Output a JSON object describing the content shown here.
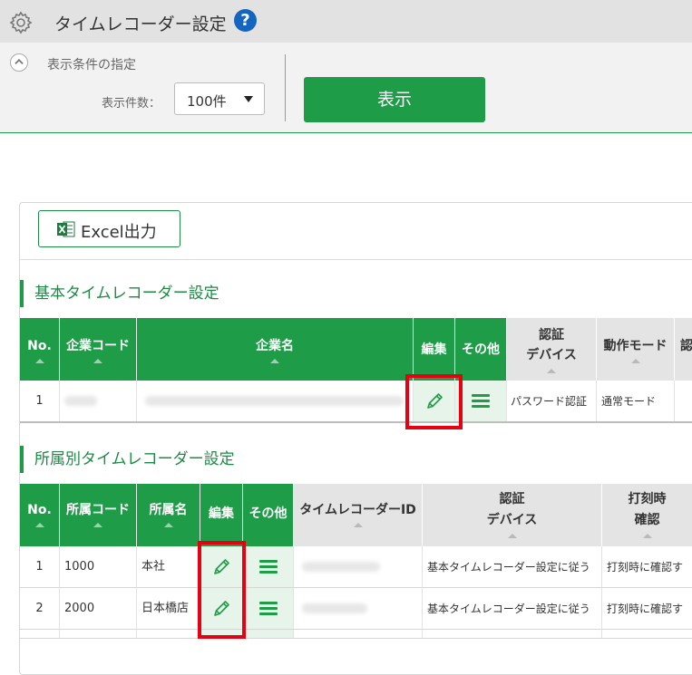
{
  "header": {
    "title": "タイムレコーダー設定",
    "help_glyph": "?"
  },
  "filter": {
    "title": "表示条件の指定",
    "count_label": "表示件数：",
    "count_value": "100件",
    "show_button": "表示"
  },
  "toolbar": {
    "excel_button": "Excel出力",
    "excel_icon": "excel-icon"
  },
  "basic": {
    "title": "基本タイムレコーダー設定",
    "headers": {
      "no": "No.",
      "company_code": "企業コード",
      "company_name": "企業名",
      "edit": "編集",
      "other": "その他",
      "auth_device_1": "認証",
      "auth_device_2": "デバイス",
      "mode": "動作モード",
      "cut": "認"
    },
    "rows": [
      {
        "no": "1",
        "auth_device": "パスワード認証",
        "mode": "通常モード"
      }
    ]
  },
  "dept": {
    "title": "所属別タイムレコーダー設定",
    "headers": {
      "no": "No.",
      "dept_code": "所属コード",
      "dept_name": "所属名",
      "edit": "編集",
      "other": "その他",
      "recorder_id": "タイムレコーダーID",
      "auth_device_1": "認証",
      "auth_device_2": "デバイス",
      "stamp_confirm_1": "打刻時",
      "stamp_confirm_2": "確認"
    },
    "rows": [
      {
        "no": "1",
        "code": "1000",
        "name": "本社",
        "auth_device": "基本タイムレコーダー設定に従う",
        "stamp_confirm": "打刻時に確認す"
      },
      {
        "no": "2",
        "code": "2000",
        "name": "日本橋店",
        "auth_device": "基本タイムレコーダー設定に従う",
        "stamp_confirm": "打刻時に確認す"
      }
    ]
  },
  "colors": {
    "accent": "#1e9c48",
    "highlight": "#e50012"
  }
}
